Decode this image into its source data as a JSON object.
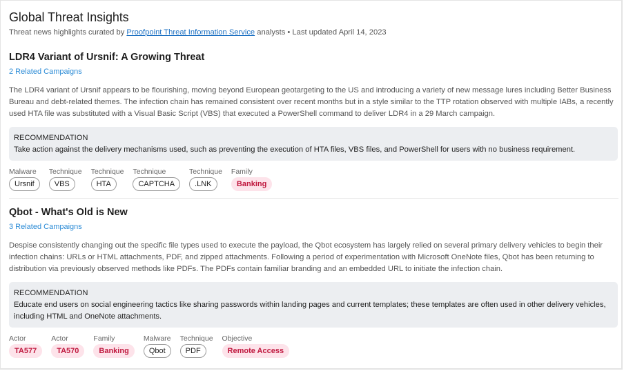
{
  "header": {
    "title": "Global Threat Insights",
    "subtitle_prefix": "Threat news highlights curated by ",
    "subtitle_link": "Proofpoint Threat Information Service",
    "subtitle_suffix": " analysts • Last updated April 14, 2023"
  },
  "articles": [
    {
      "title": "LDR4 Variant of Ursnif: A Growing Threat",
      "related": "2 Related Campaigns",
      "body": "The LDR4 variant of Ursnif appears to be flourishing, moving beyond European geotargeting to the US and introducing a variety of new message lures including Better Business Bureau and debt-related themes. The infection chain has remained consistent over recent months but in a style similar to the TTP rotation observed with multiple IABs, a recently used HTA file was substituted with a Visual Basic Script (VBS) that executed a PowerShell command to deliver LDR4 in a 29 March campaign.",
      "recommendation_label": "RECOMMENDATION",
      "recommendation": "Take action against the delivery mechanisms used, such as preventing the execution of HTA files, VBS files, and PowerShell for users with no business requirement.",
      "tags": [
        {
          "label": "Malware",
          "value": "Ursnif",
          "style": "outline"
        },
        {
          "label": "Technique",
          "value": "VBS",
          "style": "outline"
        },
        {
          "label": "Technique",
          "value": "HTA",
          "style": "outline"
        },
        {
          "label": "Technique",
          "value": "CAPTCHA",
          "style": "outline"
        },
        {
          "label": "Technique",
          "value": ".LNK",
          "style": "outline"
        },
        {
          "label": "Family",
          "value": "Banking",
          "style": "pink"
        }
      ]
    },
    {
      "title": "Qbot - What's Old is New",
      "related": "3 Related Campaigns",
      "body": "Despise consistently changing out the specific file types used to execute the payload, the Qbot ecosystem has largely relied on several primary delivery vehicles to begin their infection chains: URLs or HTML attachments, PDF, and zipped attachments. Following a period of experimentation with Microsoft OneNote files, Qbot has been returning to distribution via previously observed methods like PDFs. The PDFs contain familiar branding and an embedded URL to initiate the infection chain.",
      "recommendation_label": "RECOMMENDATION",
      "recommendation": "Educate end users on social engineering tactics like sharing passwords within landing pages and current templates; these templates are often used in other delivery vehicles, including HTML and OneNote attachments.",
      "tags": [
        {
          "label": "Actor",
          "value": "TA577",
          "style": "pink"
        },
        {
          "label": "Actor",
          "value": "TA570",
          "style": "pink"
        },
        {
          "label": "Family",
          "value": "Banking",
          "style": "pink"
        },
        {
          "label": "Malware",
          "value": "Qbot",
          "style": "outline"
        },
        {
          "label": "Technique",
          "value": "PDF",
          "style": "outline"
        },
        {
          "label": "Objective",
          "value": "Remote Access",
          "style": "pink"
        }
      ]
    }
  ],
  "colors": {
    "link": "#1a6fc2",
    "related": "#2b8bd6",
    "pink_bg": "#fde3ea",
    "pink_text": "#c0193f",
    "rec_bg": "#eceef1"
  }
}
